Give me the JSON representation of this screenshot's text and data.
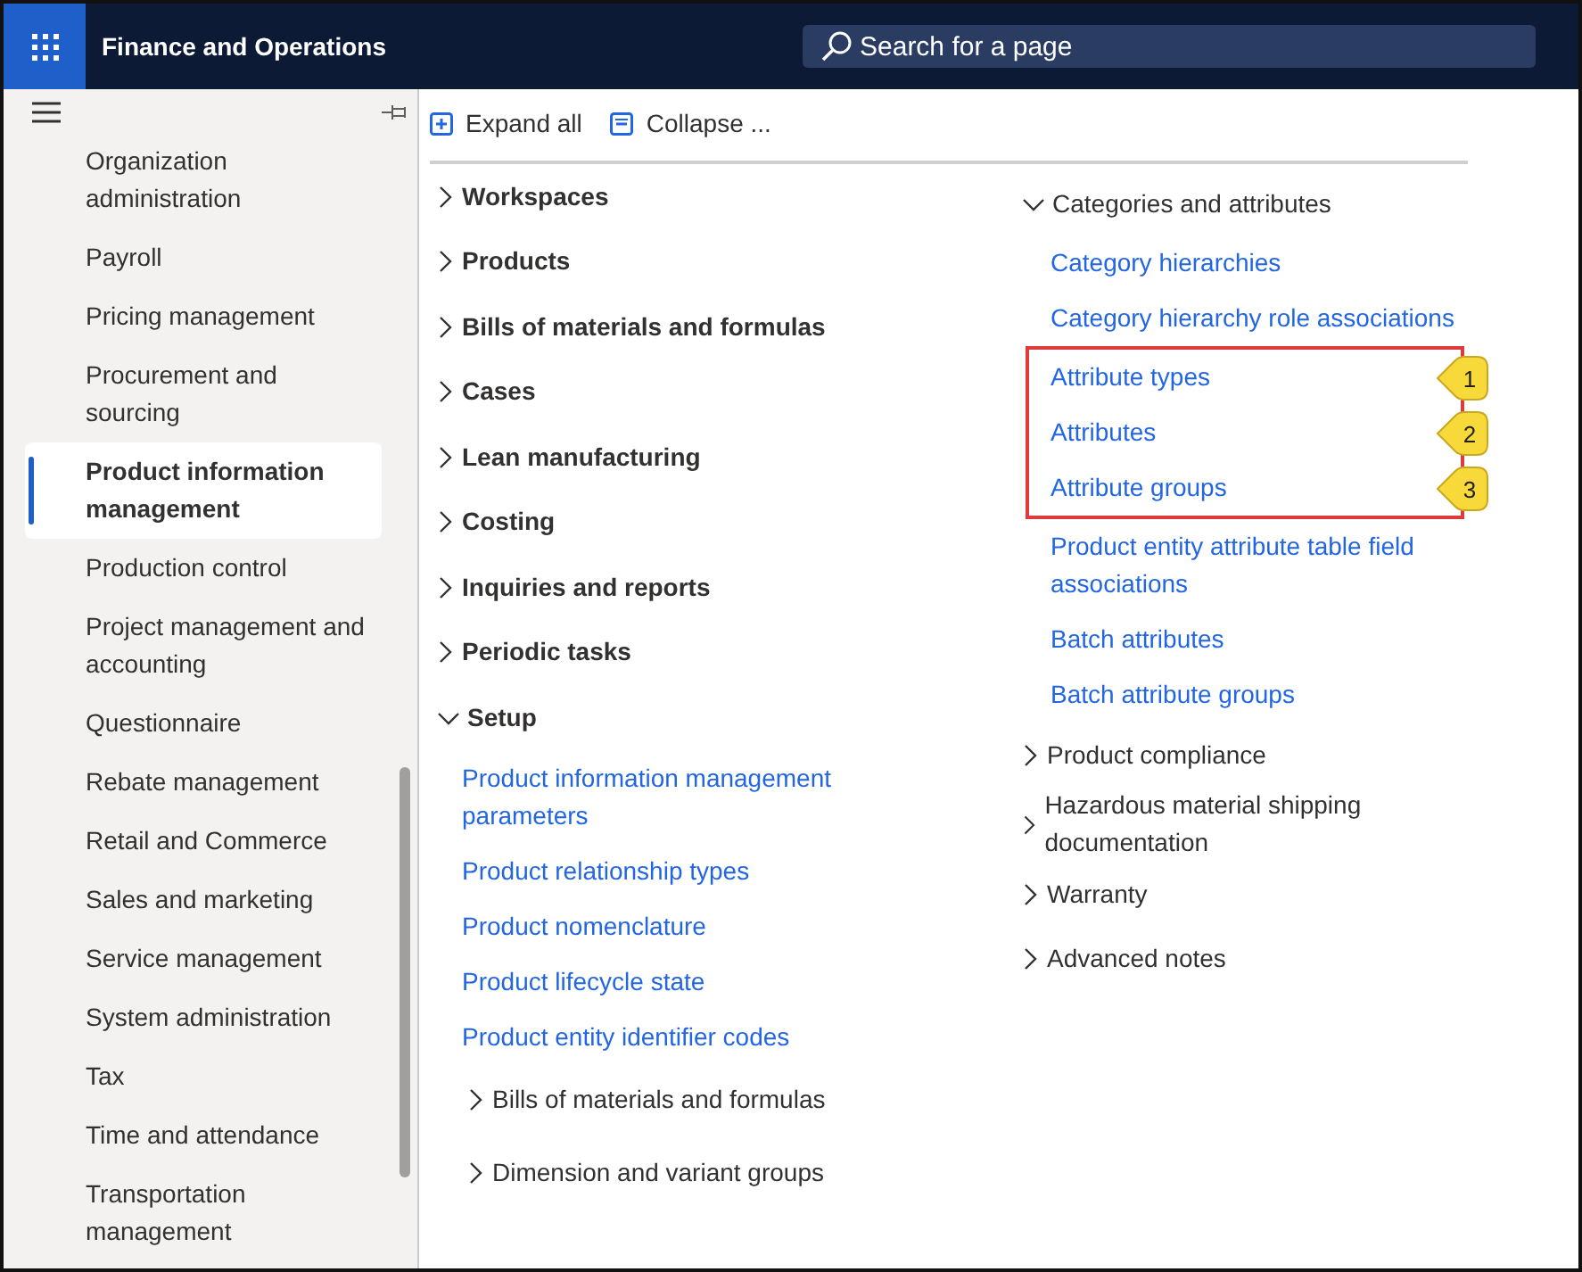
{
  "header": {
    "title": "Finance and Operations",
    "search": {
      "placeholder": "Search for a page"
    }
  },
  "sidebar": {
    "items": [
      {
        "label": "Organization administration",
        "selected": false
      },
      {
        "label": "Payroll",
        "selected": false
      },
      {
        "label": "Pricing management",
        "selected": false
      },
      {
        "label": "Procurement and sourcing",
        "selected": false
      },
      {
        "label": "Product information management",
        "selected": true
      },
      {
        "label": "Production control",
        "selected": false
      },
      {
        "label": "Project management and accounting",
        "selected": false
      },
      {
        "label": "Questionnaire",
        "selected": false
      },
      {
        "label": "Rebate management",
        "selected": false
      },
      {
        "label": "Retail and Commerce",
        "selected": false
      },
      {
        "label": "Sales and marketing",
        "selected": false
      },
      {
        "label": "Service management",
        "selected": false
      },
      {
        "label": "System administration",
        "selected": false
      },
      {
        "label": "Tax",
        "selected": false
      },
      {
        "label": "Time and attendance",
        "selected": false
      },
      {
        "label": "Transportation management",
        "selected": false
      }
    ]
  },
  "toolbar": [
    {
      "kind": "expand",
      "label": "Expand all"
    },
    {
      "kind": "collapse",
      "label": "Collapse ..."
    }
  ],
  "columns": [
    [
      {
        "kind": "group",
        "label": "Workspaces",
        "expanded": false
      },
      {
        "kind": "group",
        "label": "Products",
        "expanded": false
      },
      {
        "kind": "group",
        "label": "Bills of materials and formulas",
        "expanded": false
      },
      {
        "kind": "group",
        "label": "Cases",
        "expanded": false
      },
      {
        "kind": "group",
        "label": "Lean manufacturing",
        "expanded": false
      },
      {
        "kind": "group",
        "label": "Costing",
        "expanded": false
      },
      {
        "kind": "group",
        "label": "Inquiries and reports",
        "expanded": false
      },
      {
        "kind": "group",
        "label": "Periodic tasks",
        "expanded": false
      },
      {
        "kind": "group",
        "label": "Setup",
        "expanded": true,
        "children": [
          {
            "kind": "link",
            "label": "Product information management parameters"
          },
          {
            "kind": "link",
            "label": "Product relationship types"
          },
          {
            "kind": "link",
            "label": "Product nomenclature"
          },
          {
            "kind": "link",
            "label": "Product lifecycle state"
          },
          {
            "kind": "link",
            "label": "Product entity identifier codes"
          },
          {
            "kind": "subgroup",
            "label": "Bills of materials and formulas",
            "expanded": false
          },
          {
            "kind": "subgroup",
            "label": "Dimension and variant groups",
            "expanded": false
          }
        ]
      }
    ],
    [
      {
        "kind": "section",
        "label": "Categories and attributes",
        "expanded": true,
        "children": [
          {
            "kind": "link",
            "label": "Category hierarchies",
            "highlighted": false
          },
          {
            "kind": "link",
            "label": "Category hierarchy role associations",
            "highlighted": false
          },
          {
            "kind": "link",
            "label": "Attribute types",
            "highlighted": true,
            "callout": "1"
          },
          {
            "kind": "link",
            "label": "Attributes",
            "highlighted": true,
            "callout": "2"
          },
          {
            "kind": "link",
            "label": "Attribute groups",
            "highlighted": true,
            "callout": "3"
          },
          {
            "kind": "link",
            "label": "Product entity attribute table field associations",
            "highlighted": false
          },
          {
            "kind": "link",
            "label": "Batch attributes",
            "highlighted": false
          },
          {
            "kind": "link",
            "label": "Batch attribute groups",
            "highlighted": false
          }
        ]
      },
      {
        "kind": "section",
        "label": "Product compliance",
        "expanded": false
      },
      {
        "kind": "section",
        "label": "Hazardous material shipping documentation",
        "expanded": false
      },
      {
        "kind": "section",
        "label": "Warranty",
        "expanded": false
      },
      {
        "kind": "section",
        "label": "Advanced notes",
        "expanded": false
      }
    ]
  ]
}
